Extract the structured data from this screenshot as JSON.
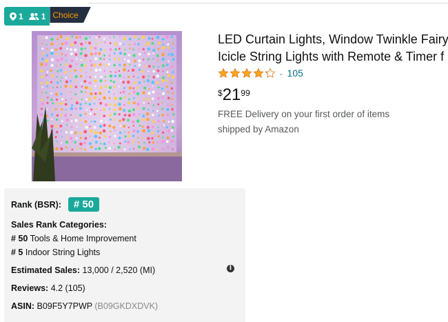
{
  "badges": {
    "location_count": "1",
    "sellers_count": "1",
    "choice_label": "Choice"
  },
  "product": {
    "title_line1": "LED Curtain Lights, Window Twinkle Fairy",
    "title_line2": "Icicle String Lights with Remote & Timer f",
    "rating_value": 4.2,
    "rating_count": "105",
    "price_symbol": "$",
    "price_whole": "21",
    "price_fraction": "99",
    "delivery_line1": "FREE Delivery on your first order of items",
    "delivery_line2": "shipped by Amazon"
  },
  "details": {
    "rank_label": "Rank (BSR):",
    "rank_value": "# 50",
    "categories_label": "Sales Rank Categories:",
    "categories": [
      {
        "rank": "# 50",
        "name": "Tools & Home Improvement"
      },
      {
        "rank": "# 5",
        "name": "Indoor String Lights"
      }
    ],
    "estimated_sales_label": "Estimated Sales:",
    "estimated_sales_value": "13,000 / 2,520 (MI)",
    "reviews_label": "Reviews:",
    "reviews_value": "4.2 (105)",
    "asin_label": "ASIN:",
    "asin_value": "B09F5Y7PWP",
    "asin_parent": "(B09GKDXDVK)"
  },
  "colors": {
    "teal": "#1aa99a",
    "star": "#ffa41c",
    "link": "#007185",
    "choice_bg": "#232f3e",
    "choice_text": "#ff9900"
  }
}
